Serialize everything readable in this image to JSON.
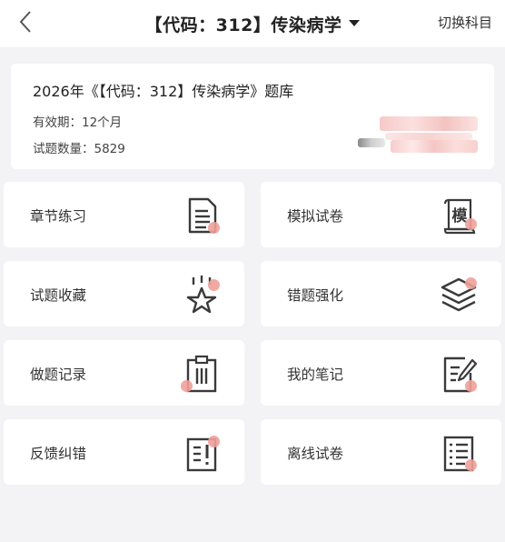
{
  "header": {
    "title": "【代码：312】传染病学",
    "switch_label": "切换科目",
    "icons": [
      "back-arrow-icon",
      "dropdown-caret-icon"
    ]
  },
  "info": {
    "bank_title": "2026年《【代码：312】传染病学》题库",
    "validity": "有效期：12个月",
    "question_count": "试题数量：5829"
  },
  "menu": [
    {
      "label": "章节练习",
      "icon": "document-icon"
    },
    {
      "label": "模拟试卷",
      "icon": "scroll-exam-icon"
    },
    {
      "label": "试题收藏",
      "icon": "star-icon"
    },
    {
      "label": "错题强化",
      "icon": "layers-icon"
    },
    {
      "label": "做题记录",
      "icon": "clipboard-icon"
    },
    {
      "label": "我的笔记",
      "icon": "note-pen-icon"
    },
    {
      "label": "反馈纠错",
      "icon": "feedback-list-icon"
    },
    {
      "label": "离线试卷",
      "icon": "offline-paper-icon"
    }
  ],
  "colors": {
    "accent_dot": "#f0a09a",
    "icon_stroke": "#3a3a3a",
    "background": "#f3f3f5"
  }
}
